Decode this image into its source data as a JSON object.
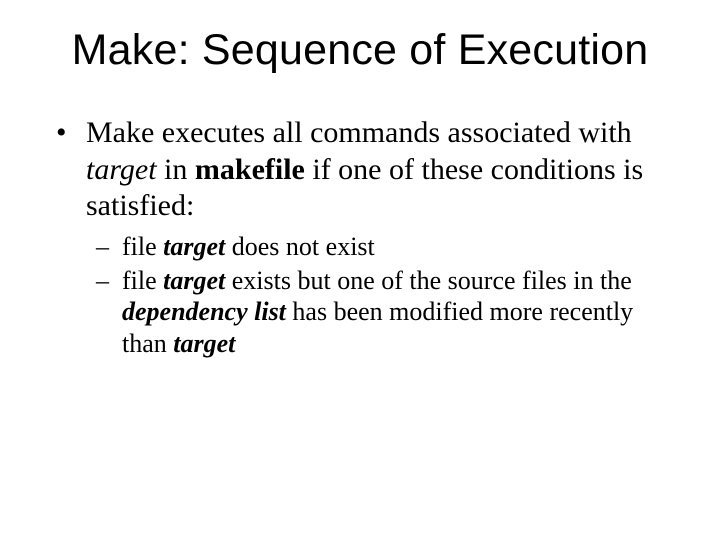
{
  "title": "Make: Sequence of Execution",
  "b1": {
    "pre": "Make executes all commands associated with ",
    "target": "target",
    "mid1": " in ",
    "makefile": "makefile",
    "post": " if one of these conditions is satisfied:"
  },
  "s1": {
    "pre": "file ",
    "target": "target",
    "post": " does not exist"
  },
  "s2": {
    "pre": "file ",
    "target": "target",
    "mid1": " exists but one of the source files in the ",
    "deplist": "dependency list",
    "mid2": " has been modified more recently than ",
    "target2": "target"
  }
}
